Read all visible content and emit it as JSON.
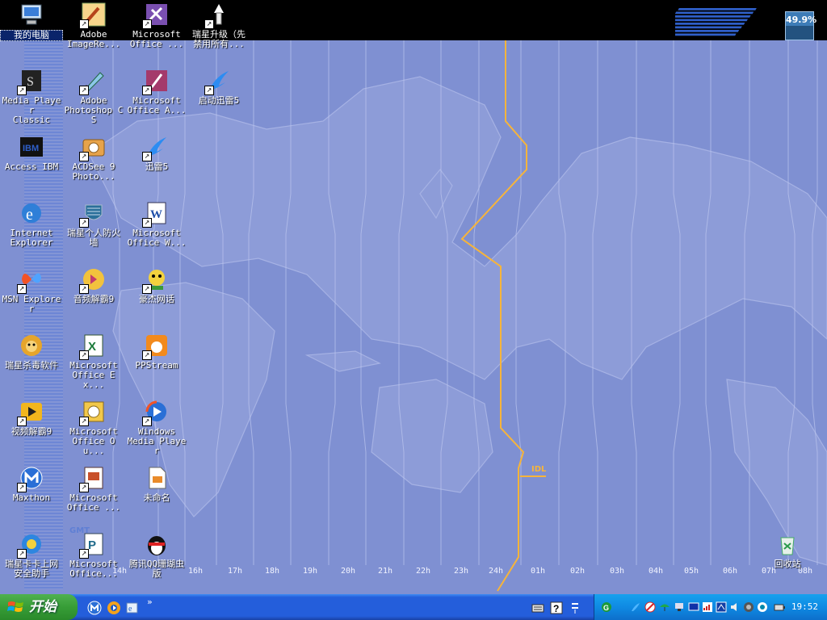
{
  "desktop": {
    "cpu_meter": {
      "text": "49.9%",
      "level": 0.499
    },
    "gmt_label": "GMT",
    "idl_label": "IDL",
    "hours": [
      "14h",
      "16h",
      "17h",
      "18h",
      "19h",
      "20h",
      "21h",
      "22h",
      "23h",
      "24h",
      "01h",
      "02h",
      "03h",
      "04h",
      "05h",
      "06h",
      "07h",
      "08h"
    ],
    "icons": [
      {
        "label": "我的电脑",
        "icon": "my-computer-icon",
        "shortcut": false,
        "selected": true
      },
      {
        "label": "Adobe\nImageRe...",
        "icon": "adobe-imageready-icon",
        "shortcut": true
      },
      {
        "label": "Microsoft\nOffice ...",
        "icon": "office-infopath-icon",
        "shortcut": true
      },
      {
        "label": "瑞星升级（先\n禁用所有...",
        "icon": "rising-update-icon",
        "shortcut": true
      },
      {
        "label": "Media Player\nClassic",
        "icon": "media-player-classic-icon",
        "shortcut": true
      },
      {
        "label": "Adobe\nPhotoshop CS",
        "icon": "photoshop-icon",
        "shortcut": true
      },
      {
        "label": "Microsoft\nOffice A...",
        "icon": "office-access-icon",
        "shortcut": true
      },
      {
        "label": "启动迅雷5",
        "icon": "thunder-icon",
        "shortcut": true
      },
      {
        "label": "Access IBM",
        "icon": "access-ibm-icon",
        "shortcut": false
      },
      {
        "label": "ACDSee 9\nPhoto...",
        "icon": "acdsee-icon",
        "shortcut": true
      },
      {
        "label": "迅雷5",
        "icon": "thunder-icon",
        "shortcut": true
      },
      {
        "label": "Internet\nExplorer",
        "icon": "internet-explorer-icon",
        "shortcut": false
      },
      {
        "label": "瑞星个人防火\n墙",
        "icon": "rising-firewall-icon",
        "shortcut": true
      },
      {
        "label": "Microsoft\nOffice W...",
        "icon": "office-word-icon",
        "shortcut": true
      },
      {
        "label": "MSN Explorer",
        "icon": "msn-butterfly-icon",
        "shortcut": true
      },
      {
        "label": "音频解霸9",
        "icon": "audio-player-icon",
        "shortcut": true
      },
      {
        "label": "豪杰网话",
        "icon": "haojie-phone-icon",
        "shortcut": true
      },
      {
        "label": "瑞星杀毒软件",
        "icon": "rising-antivirus-lion-icon",
        "shortcut": false
      },
      {
        "label": "Microsoft\nOffice Ex...",
        "icon": "office-excel-icon",
        "shortcut": true
      },
      {
        "label": "PPStream",
        "icon": "ppstream-icon",
        "shortcut": true
      },
      {
        "label": "视频解霸9",
        "icon": "video-player-icon",
        "shortcut": true
      },
      {
        "label": "Microsoft\nOffice Ou...",
        "icon": "office-outlook-icon",
        "shortcut": true
      },
      {
        "label": "Windows\nMedia Player",
        "icon": "windows-media-player-icon",
        "shortcut": true
      },
      {
        "label": "Maxthon",
        "icon": "maxthon-icon",
        "shortcut": true
      },
      {
        "label": "Microsoft\nOffice ...",
        "icon": "office-powerpoint-icon",
        "shortcut": true
      },
      {
        "label": "未命名",
        "icon": "document-icon",
        "shortcut": false
      },
      {
        "label": "瑞星卡卡上网\n安全助手",
        "icon": "rising-kaka-icon",
        "shortcut": true
      },
      {
        "label": "Microsoft\nOffice...",
        "icon": "office-publisher-icon",
        "shortcut": true
      },
      {
        "label": "腾讯QQ珊瑚虫\n版",
        "icon": "qq-penguin-icon",
        "shortcut": false
      },
      {
        "label": "回收站",
        "icon": "recycle-bin-icon",
        "shortcut": false
      }
    ]
  },
  "taskbar": {
    "start_label": "开始",
    "quick_launch": [
      "maxthon-icon",
      "media-player-icon",
      "ie-icon"
    ],
    "quick_more": "»",
    "clock": "19:52"
  },
  "colors": {
    "desktop": "#7f90d2",
    "taskbar": "#245edb",
    "start": "#379d37",
    "idl": "#f6b43b"
  }
}
